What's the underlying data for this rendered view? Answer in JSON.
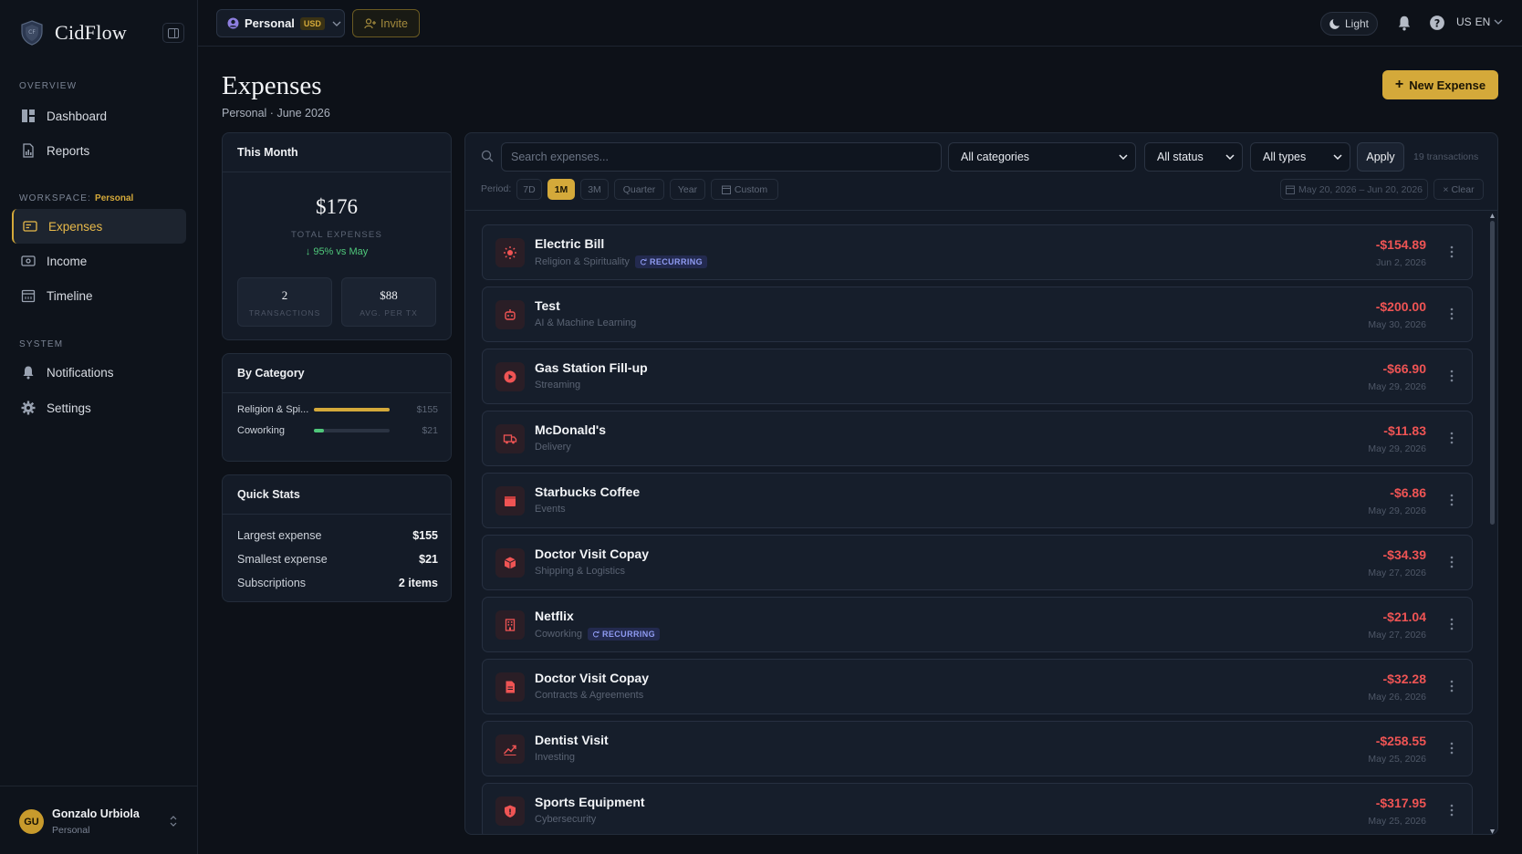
{
  "sidebar": {
    "brand": "CidFlow",
    "sections": {
      "overview": "OVERVIEW",
      "workspace": "WORKSPACE:",
      "workspace_name": "Personal",
      "system": "SYSTEM"
    },
    "items": [
      {
        "label": "Dashboard",
        "icon": "dashboard-icon"
      },
      {
        "label": "Reports",
        "icon": "reports-icon"
      },
      {
        "label": "Expenses",
        "icon": "expenses-icon",
        "active": true
      },
      {
        "label": "Income",
        "icon": "income-icon"
      },
      {
        "label": "Timeline",
        "icon": "calendar-icon"
      },
      {
        "label": "Notifications",
        "icon": "bell-icon"
      },
      {
        "label": "Settings",
        "icon": "gear-icon"
      }
    ],
    "user": {
      "initials": "GU",
      "name": "Gonzalo Urbiola",
      "workspace": "Personal"
    }
  },
  "topbar": {
    "workspace": "Personal",
    "currency": "USD",
    "invite": "Invite",
    "theme": "Light",
    "lang_flag": "US",
    "lang": "EN"
  },
  "header": {
    "title": "Expenses",
    "subtitle": "Personal · June 2026",
    "new_button": "New Expense"
  },
  "this_month": {
    "title": "This Month",
    "total": "$176",
    "total_label": "TOTAL EXPENSES",
    "delta": "↓ 95% vs May",
    "transactions": "2",
    "transactions_label": "TRANSACTIONS",
    "avg": "$88",
    "avg_label": "AVG. PER TX"
  },
  "by_category": {
    "title": "By Category",
    "items": [
      {
        "name": "Religion & Spi...",
        "value": "$155",
        "fraction": 1.0,
        "color": "#d4a93a"
      },
      {
        "name": "Coworking",
        "value": "$21",
        "fraction": 0.135,
        "color": "#4fc77a"
      }
    ]
  },
  "quick_stats": {
    "title": "Quick Stats",
    "rows": [
      {
        "label": "Largest expense",
        "value": "$155"
      },
      {
        "label": "Smallest expense",
        "value": "$21"
      },
      {
        "label": "Subscriptions",
        "value": "2 items"
      }
    ]
  },
  "filters": {
    "search_placeholder": "Search expenses...",
    "category": "All categories",
    "status": "All status",
    "type": "All types",
    "apply": "Apply",
    "count": "19 transactions",
    "period_label": "Period:",
    "periods": [
      "7D",
      "1M",
      "3M",
      "Quarter",
      "Year",
      "Custom"
    ],
    "active_period": "1M",
    "date_range": "May 20, 2026 – Jun 20, 2026",
    "clear": "× Clear"
  },
  "expenses": [
    {
      "title": "Electric Bill",
      "category": "Religion & Spirituality",
      "recurring": true,
      "amount": "-$154.89",
      "date": "Jun 2, 2026",
      "icon": "sun-icon"
    },
    {
      "title": "Test",
      "category": "AI & Machine Learning",
      "recurring": false,
      "amount": "-$200.00",
      "date": "May 30, 2026",
      "icon": "robot-icon"
    },
    {
      "title": "Gas Station Fill-up",
      "category": "Streaming",
      "recurring": false,
      "amount": "-$66.90",
      "date": "May 29, 2026",
      "icon": "play-icon"
    },
    {
      "title": "McDonald's",
      "category": "Delivery",
      "recurring": false,
      "amount": "-$11.83",
      "date": "May 29, 2026",
      "icon": "truck-icon"
    },
    {
      "title": "Starbucks Coffee",
      "category": "Events",
      "recurring": false,
      "amount": "-$6.86",
      "date": "May 29, 2026",
      "icon": "calendar-icon"
    },
    {
      "title": "Doctor Visit Copay",
      "category": "Shipping & Logistics",
      "recurring": false,
      "amount": "-$34.39",
      "date": "May 27, 2026",
      "icon": "package-icon"
    },
    {
      "title": "Netflix",
      "category": "Coworking",
      "recurring": true,
      "amount": "-$21.04",
      "date": "May 27, 2026",
      "icon": "building-icon"
    },
    {
      "title": "Doctor Visit Copay",
      "category": "Contracts & Agreements",
      "recurring": false,
      "amount": "-$32.28",
      "date": "May 26, 2026",
      "icon": "document-icon"
    },
    {
      "title": "Dentist Visit",
      "category": "Investing",
      "recurring": false,
      "amount": "-$258.55",
      "date": "May 25, 2026",
      "icon": "trending-up-icon"
    },
    {
      "title": "Sports Equipment",
      "category": "Cybersecurity",
      "recurring": false,
      "amount": "-$317.95",
      "date": "May 25, 2026",
      "icon": "shield-icon"
    }
  ],
  "recurring_label": "RECURRING",
  "colors": {
    "accent": "#d4a93a",
    "negative": "#ef5454",
    "positive": "#4fc77a",
    "recurring": "#8f9bf2"
  }
}
